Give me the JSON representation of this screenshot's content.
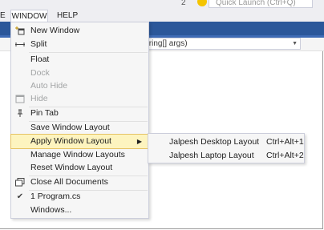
{
  "topbar": {
    "notification_count": "2",
    "quick_launch_placeholder": "Quick Launch (Ctrl+Q)"
  },
  "menubar": {
    "left_fragment": "E",
    "window": "WINDOW",
    "help": "HELP"
  },
  "navbar": {
    "method_combo": "tring[] args)"
  },
  "window_menu": {
    "new_window": "New Window",
    "split": "Split",
    "float": "Float",
    "dock": "Dock",
    "auto_hide": "Auto Hide",
    "hide": "Hide",
    "pin_tab": "Pin Tab",
    "save_window_layout": "Save Window Layout",
    "apply_window_layout": "Apply Window Layout",
    "manage_window_layouts": "Manage Window Layouts",
    "reset_window_layout": "Reset Window Layout",
    "close_all_documents": "Close All Documents",
    "open_document": "1 Program.cs",
    "windows": "Windows..."
  },
  "layout_submenu": {
    "items": [
      {
        "label": "Jalpesh Desktop Layout",
        "shortcut": "Ctrl+Alt+1"
      },
      {
        "label": "Jalpesh Laptop Layout",
        "shortcut": "Ctrl+Alt+2"
      }
    ]
  },
  "colors": {
    "tab_bar": "#2b579a",
    "highlight": "#fdf4bf",
    "menu_background": "#f6f6f6",
    "disabled_text": "#a2a4a5"
  }
}
